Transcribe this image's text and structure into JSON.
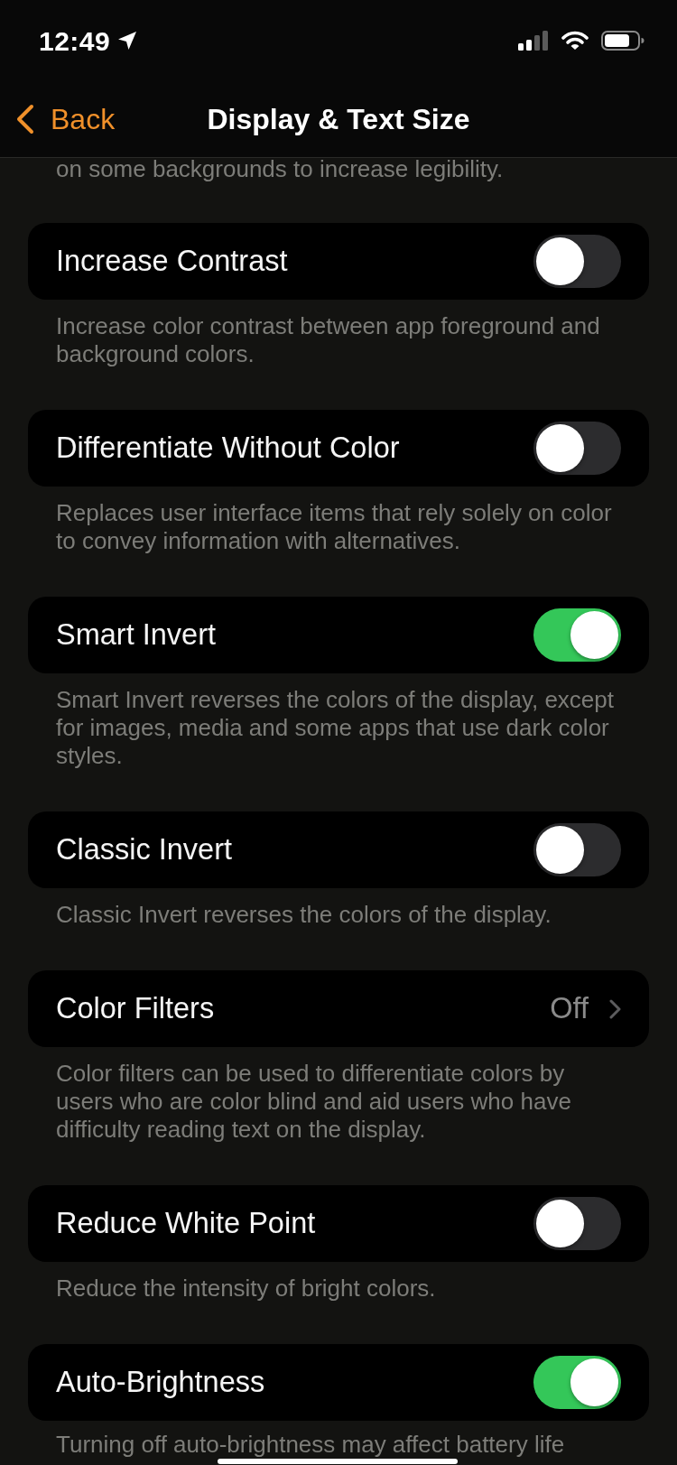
{
  "status_bar": {
    "time": "12:49"
  },
  "nav": {
    "back": "Back",
    "title": "Display & Text Size"
  },
  "top_note": "on some backgrounds to increase legibility.",
  "items": [
    {
      "kind": "toggle",
      "label": "Increase Contrast",
      "on": false,
      "footer": "Increase color contrast between app foreground and background colors."
    },
    {
      "kind": "toggle",
      "label": "Differentiate Without Color",
      "on": false,
      "footer": "Replaces user interface items that rely solely on color to convey information with alternatives."
    },
    {
      "kind": "toggle",
      "label": "Smart Invert",
      "on": true,
      "footer": "Smart Invert reverses the colors of the display, except for images, media and some apps that use dark color styles."
    },
    {
      "kind": "toggle",
      "label": "Classic Invert",
      "on": false,
      "footer": "Classic Invert reverses the colors of the display."
    },
    {
      "kind": "link",
      "label": "Color Filters",
      "value": "Off",
      "footer": "Color filters can be used to differentiate colors by users who are color blind and aid users who have difficulty reading text on the display."
    },
    {
      "kind": "toggle",
      "label": "Reduce White Point",
      "on": false,
      "footer": "Reduce the intensity of bright colors."
    },
    {
      "kind": "toggle",
      "label": "Auto-Brightness",
      "on": true,
      "footer": "Turning off auto-brightness may affect battery life"
    }
  ]
}
